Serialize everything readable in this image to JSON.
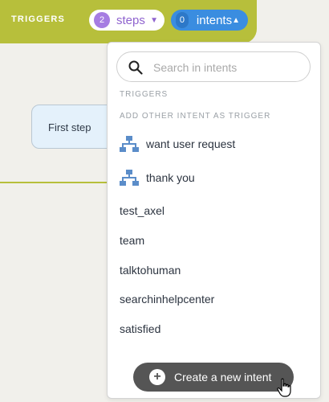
{
  "header": {
    "triggers_label": "TRIGGERS",
    "steps_count": "2",
    "steps_label": "steps",
    "intents_count": "0",
    "intents_label": "intents"
  },
  "canvas": {
    "step_card_label": "First step"
  },
  "dropdown": {
    "search_placeholder": "Search in intents",
    "section_triggers": "TRIGGERS",
    "section_add": "ADD OTHER INTENT AS TRIGGER",
    "items": [
      {
        "label": "want user request",
        "icon": "hierarchy-icon"
      },
      {
        "label": "thank you",
        "icon": "hierarchy-icon"
      },
      {
        "label": "test_axel"
      },
      {
        "label": "team"
      },
      {
        "label": "talktohuman"
      },
      {
        "label": "searchinhelpcenter"
      },
      {
        "label": "satisfied"
      }
    ],
    "create_button_label": "Create a new intent"
  },
  "colors": {
    "header_bg": "#b7bf3b",
    "steps_accent": "#8f63cf",
    "intents_accent": "#3a8de0",
    "icon_blue": "#5b8dc9"
  }
}
